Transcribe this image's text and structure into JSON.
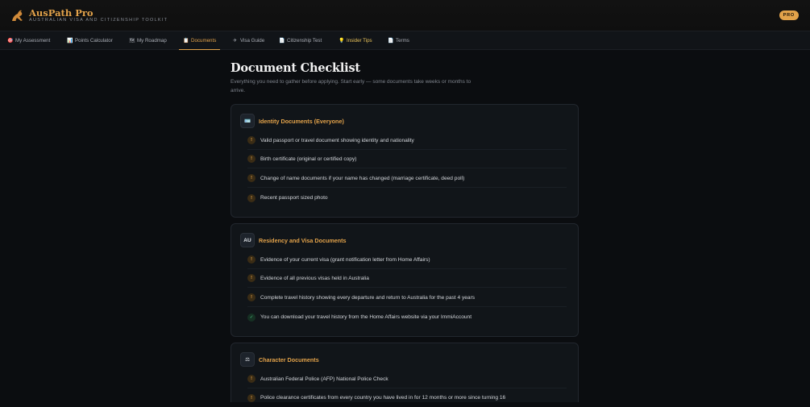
{
  "brand": {
    "name": "AusPath Pro",
    "tagline": "AUSTRALIAN VISA AND CITIZENSHIP TOOLKIT",
    "badge": "PRO",
    "accent": "#e2a24a"
  },
  "nav": [
    {
      "icon": "target-icon",
      "glyph": "🎯",
      "label": "My Assessment"
    },
    {
      "icon": "chart-icon",
      "glyph": "📊",
      "label": "Points Calculator"
    },
    {
      "icon": "map-icon",
      "glyph": "🗺",
      "label": "My Roadmap"
    },
    {
      "icon": "clipboard-icon",
      "glyph": "📋",
      "label": "Documents",
      "active": true
    },
    {
      "icon": "plane-icon",
      "glyph": "✈",
      "label": "Visa Guide"
    },
    {
      "icon": "document-icon",
      "glyph": "📄",
      "label": "Citizenship Test"
    },
    {
      "icon": "lightbulb-icon",
      "glyph": "💡",
      "label": "Insider Tips"
    },
    {
      "icon": "page-icon",
      "glyph": "📄",
      "label": "Terms"
    }
  ],
  "page": {
    "title": "Document Checklist",
    "subtitle": "Everything you need to gather before applying. Start early — some documents take weeks or months to arrive."
  },
  "sections": [
    {
      "icon": "id-card-icon",
      "icon_glyph": "🪪",
      "title": "Identity Documents (Everyone)",
      "items": [
        {
          "status": "pending",
          "mark": "!",
          "text": "Valid passport or travel document showing identity and nationality"
        },
        {
          "status": "pending",
          "mark": "!",
          "text": "Birth certificate (original or certified copy)"
        },
        {
          "status": "pending",
          "mark": "!",
          "text": "Change of name documents if your name has changed (marriage certificate, deed poll)"
        },
        {
          "status": "pending",
          "mark": "!",
          "text": "Recent passport sized photo"
        }
      ]
    },
    {
      "icon": "au-flag-icon",
      "icon_glyph": "AU",
      "title": "Residency and Visa Documents",
      "items": [
        {
          "status": "pending",
          "mark": "!",
          "text": "Evidence of your current visa (grant notification letter from Home Affairs)"
        },
        {
          "status": "pending",
          "mark": "!",
          "text": "Evidence of all previous visas held in Australia"
        },
        {
          "status": "pending",
          "mark": "!",
          "text": "Complete travel history showing every departure and return to Australia for the past 4 years"
        },
        {
          "status": "done",
          "mark": "✓",
          "text": "You can download your travel history from the Home Affairs website via your ImmiAccount"
        }
      ]
    },
    {
      "icon": "scales-icon",
      "icon_glyph": "⚖",
      "title": "Character Documents",
      "items": [
        {
          "status": "pending",
          "mark": "!",
          "text": "Australian Federal Police (AFP) National Police Check"
        },
        {
          "status": "pending",
          "mark": "!",
          "text": "Police clearance certificates from every country you have lived in for 12 months or more since turning 16"
        }
      ]
    }
  ]
}
